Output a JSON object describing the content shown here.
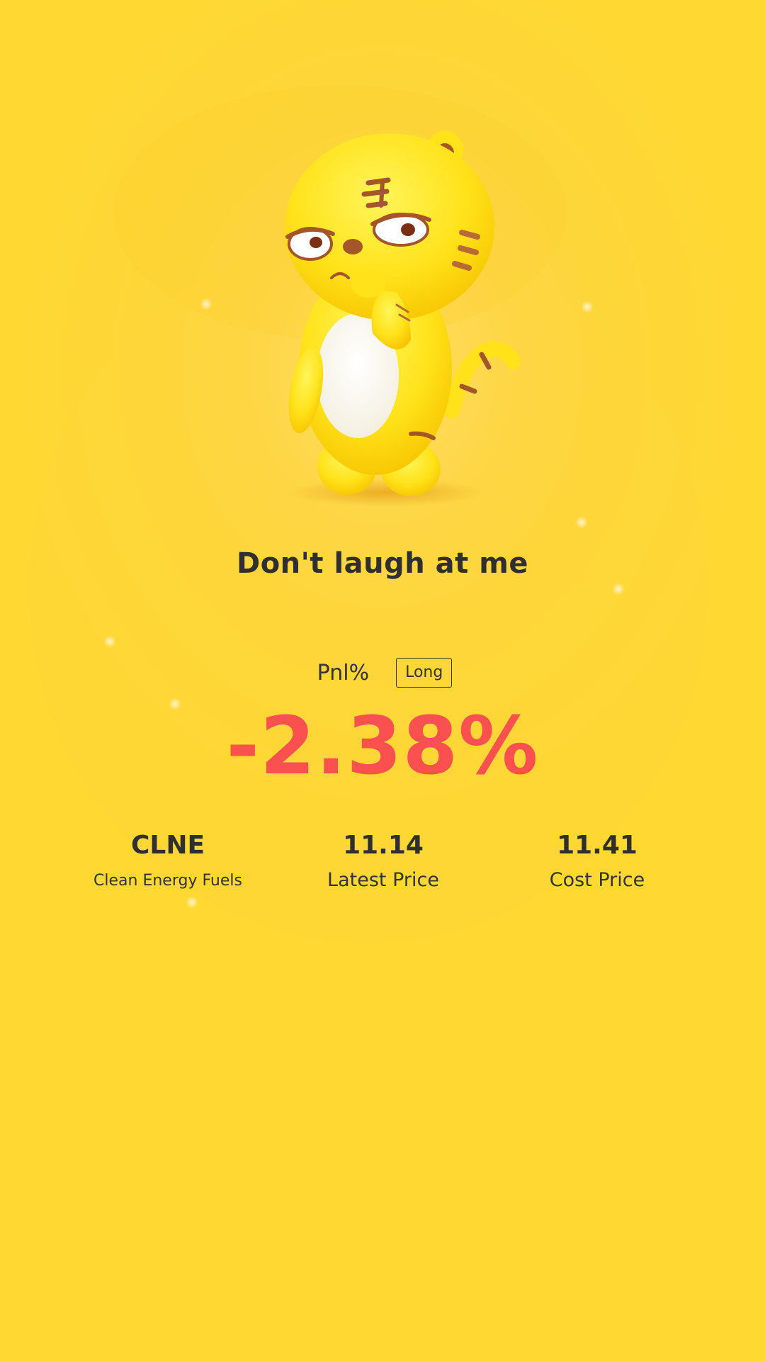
{
  "headline": "Don't laugh at me",
  "pnl": {
    "label": "Pnl%",
    "position_badge": "Long",
    "value": "-2.38%"
  },
  "stats": {
    "symbol": "CLNE",
    "company_name": "Clean Energy Fuels",
    "latest_price": "11.14",
    "latest_price_label": "Latest Price",
    "cost_price": "11.41",
    "cost_price_label": "Cost Price"
  },
  "mascot": {
    "icon": "tiger-mascot-icon"
  },
  "colors": {
    "background": "#fdd63a",
    "negative": "#fa5050",
    "text": "#2f2f2f"
  }
}
